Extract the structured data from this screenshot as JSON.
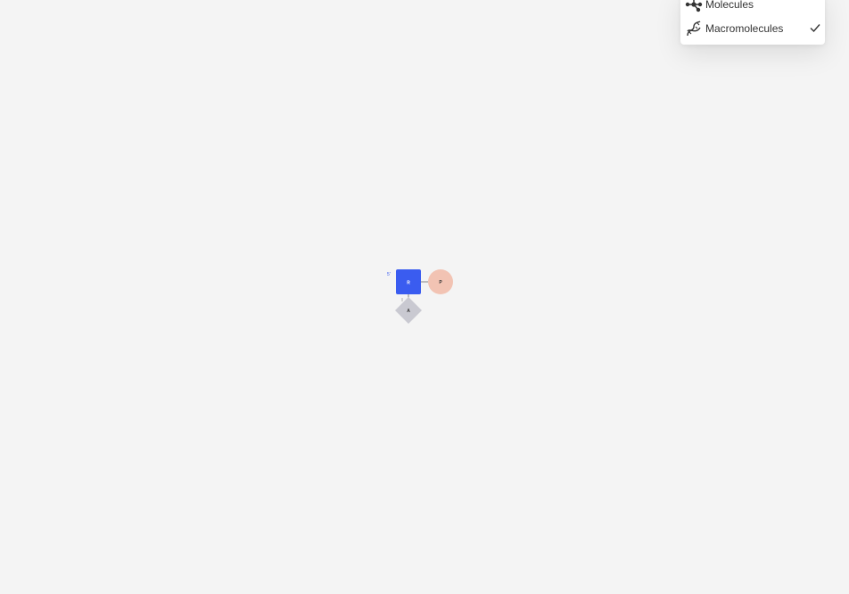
{
  "menu": {
    "items": [
      {
        "label": "Molecules",
        "icon": "molecules-icon",
        "selected": false
      },
      {
        "label": "Macromolecules",
        "icon": "macromolecules-icon",
        "selected": true
      }
    ]
  },
  "sequence": {
    "strand_end_label": "5'",
    "sugar_label": "R",
    "phosphate_label": "P",
    "base_label": "A",
    "colors": {
      "sugar": "#3a5cf0",
      "phosphate": "#f2c3b3",
      "base": "#c9c9d1"
    }
  }
}
